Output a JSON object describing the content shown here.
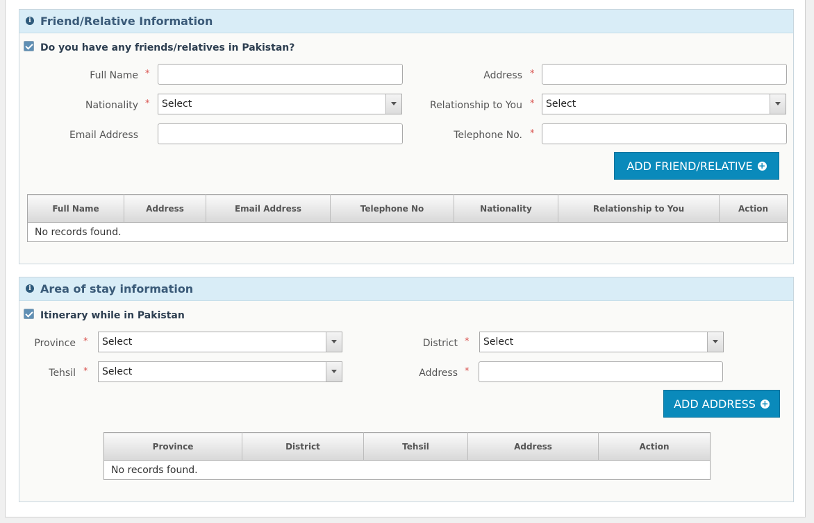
{
  "friends_section": {
    "title": "Friend/Relative Information",
    "checkbox_label": "Do you have any friends/relatives in Pakistan?",
    "fields": {
      "full_name_label": "Full Name",
      "address_label": "Address",
      "nationality_label": "Nationality",
      "nationality_value": "Select",
      "relationship_label": "Relationship to You",
      "relationship_value": "Select",
      "email_label": "Email Address",
      "telephone_label": "Telephone No."
    },
    "required_mark": "*",
    "add_button": "ADD FRIEND/RELATIVE",
    "table": {
      "columns": [
        "Full Name",
        "Address",
        "Email Address",
        "Telephone No",
        "Nationality",
        "Relationship to You",
        "Action"
      ],
      "empty_text": "No records found."
    }
  },
  "stay_section": {
    "title": "Area of stay information",
    "checkbox_label": "Itinerary while in Pakistan",
    "fields": {
      "province_label": "Province",
      "province_value": "Select",
      "district_label": "District",
      "district_value": "Select",
      "tehsil_label": "Tehsil",
      "tehsil_value": "Select",
      "address_label": "Address"
    },
    "required_mark": "*",
    "add_button": "ADD ADDRESS",
    "table": {
      "columns": [
        "Province",
        "District",
        "Tehsil",
        "Address",
        "Action"
      ],
      "empty_text": "No records found."
    }
  },
  "colors": {
    "header_bg": "#d9edf7",
    "button_bg": "#0a8abb",
    "required": "#d9534f"
  },
  "icons": {
    "info": "info-circle-icon",
    "add": "plus-circle-icon",
    "dropdown": "chevron-down-icon"
  }
}
